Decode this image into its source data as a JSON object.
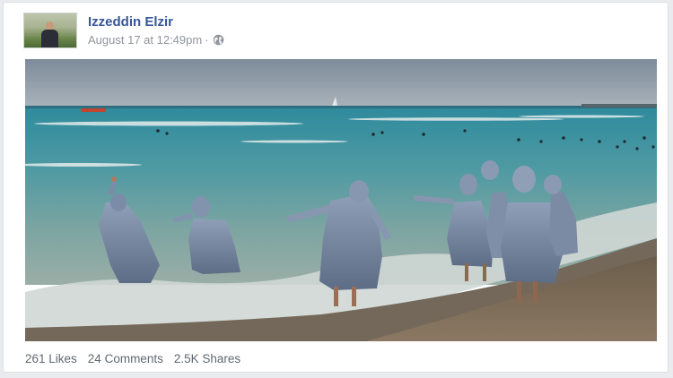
{
  "post": {
    "author": "Izzeddin Elzir",
    "timestamp": "August 17 at 12:49pm",
    "separator": "·",
    "privacy_icon": "globe-icon"
  },
  "photo": {
    "subject": "beach-photo"
  },
  "stats": {
    "likes": "261 Likes",
    "comments": "24 Comments",
    "shares": "2.5K Shares"
  },
  "colors": {
    "author_link": "#365899",
    "meta_text": "#90949c",
    "stats_text": "#616770",
    "page_bg": "#e9ebee"
  }
}
